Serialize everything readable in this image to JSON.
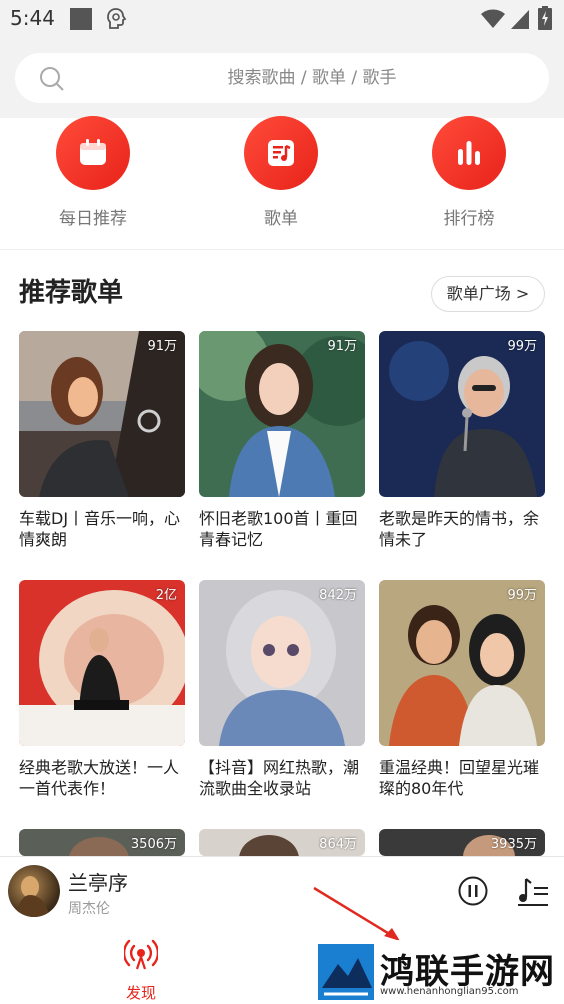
{
  "status_bar": {
    "time": "5:44"
  },
  "search": {
    "placeholder": "搜索歌曲 / 歌单 / 歌手"
  },
  "categories": [
    {
      "label": "每日推荐",
      "icon": "calendar-icon"
    },
    {
      "label": "歌单",
      "icon": "music-note-icon"
    },
    {
      "label": "排行榜",
      "icon": "bar-chart-icon"
    }
  ],
  "section": {
    "title": "推荐歌单",
    "more_label": "歌单广场 >"
  },
  "playlists": [
    {
      "count": "91万",
      "title": "车载DJ丨音乐一响，心情爽朗"
    },
    {
      "count": "91万",
      "title": "怀旧老歌100首丨重回青春记忆"
    },
    {
      "count": "99万",
      "title": "老歌是昨天的情书，余情未了"
    },
    {
      "count": "2亿",
      "title": "经典老歌大放送！一人一首代表作！"
    },
    {
      "count": "842万",
      "title": "【抖音】网红热歌，潮流歌曲全收录站"
    },
    {
      "count": "99万",
      "title": "重温经典！回望星光璀璨的80年代"
    },
    {
      "count": "3506万",
      "title": ""
    },
    {
      "count": "864万",
      "title": ""
    },
    {
      "count": "3935万",
      "title": ""
    }
  ],
  "player": {
    "title": "兰亭序",
    "artist": "周杰伦"
  },
  "nav": {
    "discover_label": "发现"
  },
  "watermark": {
    "name": "鸿联手游网",
    "url": "www.henanhonglian95.com"
  },
  "colors": {
    "accent": "#e8231a",
    "header_bg": "#f2f2f2"
  }
}
